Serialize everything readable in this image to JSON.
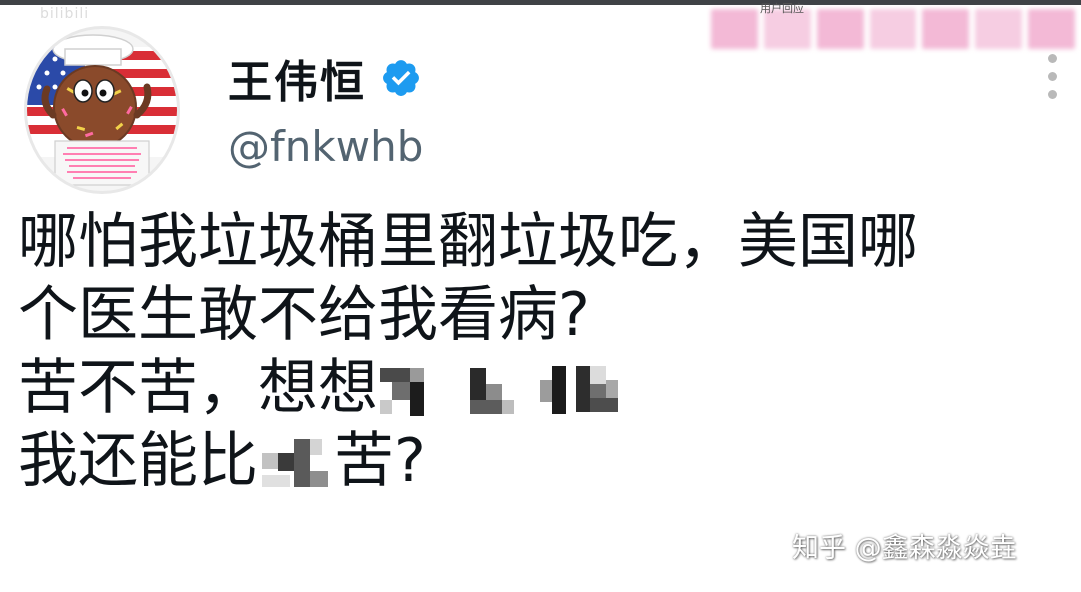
{
  "watermark_top": "bilibili",
  "redacted_note": "用户回应",
  "profile": {
    "display_name": "王伟恒",
    "handle": "@fnkwhb",
    "verified_icon": "verified-badge-icon",
    "avatar_icon": "donut-cartoon-avatar",
    "more_icon": "vertical-dots-icon"
  },
  "tweet": {
    "line1": "哪怕我垃圾桶里翻垃圾吃，美国哪",
    "line2": "个医生敢不给我看病?",
    "line3_prefix": "苦不苦，想想",
    "line4_prefix": "我还能比",
    "line4_suffix": "苦?"
  },
  "watermark_zhihu": "知乎 @鑫森淼焱垚",
  "colors": {
    "text": "#0f1419",
    "handle": "#536471",
    "verified": "#1d9bf0",
    "pink_blur": "#f3b9d6"
  }
}
